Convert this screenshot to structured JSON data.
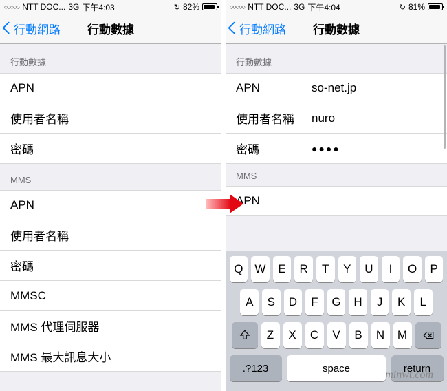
{
  "left": {
    "status": {
      "signal": "○○○○○",
      "carrier": "NTT DOC...",
      "network": "3G",
      "time": "下午4:03",
      "lock": "↻",
      "battery_pct": "82%",
      "battery_fill": 82
    },
    "nav": {
      "back": "行動網路",
      "title": "行動數據"
    },
    "section1": {
      "header": "行動數據",
      "rows": [
        {
          "label": "APN",
          "value": ""
        },
        {
          "label": "使用者名稱",
          "value": ""
        },
        {
          "label": "密碼",
          "value": ""
        }
      ]
    },
    "section2": {
      "header": "MMS",
      "rows": [
        {
          "label": "APN",
          "value": ""
        },
        {
          "label": "使用者名稱",
          "value": ""
        },
        {
          "label": "密碼",
          "value": ""
        },
        {
          "label": "MMSC",
          "value": ""
        },
        {
          "label": "MMS 代理伺服器",
          "value": ""
        },
        {
          "label": "MMS 最大訊息大小",
          "value": ""
        }
      ]
    }
  },
  "right": {
    "status": {
      "signal": "○○○○○",
      "carrier": "NTT DOC...",
      "network": "3G",
      "time": "下午4:04",
      "lock": "↻",
      "battery_pct": "81%",
      "battery_fill": 81
    },
    "nav": {
      "back": "行動網路",
      "title": "行動數據"
    },
    "section1": {
      "header": "行動數據",
      "rows": [
        {
          "label": "APN",
          "value": "so-net.jp"
        },
        {
          "label": "使用者名稱",
          "value": "nuro"
        },
        {
          "label": "密碼",
          "value": "●●●●"
        }
      ]
    },
    "section2": {
      "header": "MMS",
      "rows": [
        {
          "label": "APN",
          "value": ""
        }
      ]
    },
    "keyboard": {
      "row1": [
        "Q",
        "W",
        "E",
        "R",
        "T",
        "Y",
        "U",
        "I",
        "O",
        "P"
      ],
      "row2": [
        "A",
        "S",
        "D",
        "F",
        "G",
        "H",
        "J",
        "K",
        "L"
      ],
      "row3": [
        "Z",
        "X",
        "C",
        "V",
        "B",
        "N",
        "M"
      ],
      "mode": ".?123",
      "space": "space",
      "return": "return"
    }
  },
  "watermark": "minwt.com"
}
